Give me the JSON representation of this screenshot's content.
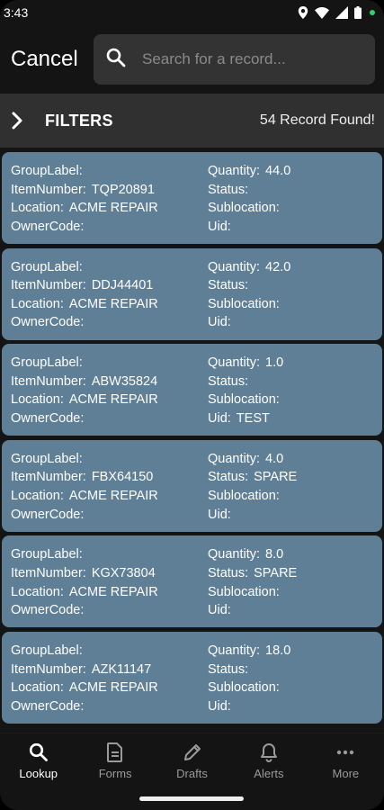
{
  "status_bar": {
    "time": "3:43"
  },
  "header": {
    "cancel_label": "Cancel",
    "search_placeholder": "Search for a record..."
  },
  "filters": {
    "label": "FILTERS",
    "record_count": "54 Record Found!"
  },
  "field_labels": {
    "group_label": "GroupLabel:",
    "item_number": "ItemNumber:",
    "location": "Location:",
    "owner_code": "OwnerCode:",
    "quantity": "Quantity:",
    "status": "Status:",
    "sublocation": "Sublocation:",
    "uid": "Uid:"
  },
  "records": [
    {
      "group_label": "",
      "item_number": "TQP20891",
      "location": "ACME REPAIR",
      "owner_code": "",
      "quantity": "44.0",
      "status": "",
      "sublocation": "",
      "uid": ""
    },
    {
      "group_label": "",
      "item_number": "DDJ44401",
      "location": "ACME REPAIR",
      "owner_code": "",
      "quantity": "42.0",
      "status": "",
      "sublocation": "",
      "uid": ""
    },
    {
      "group_label": "",
      "item_number": "ABW35824",
      "location": "ACME REPAIR",
      "owner_code": "",
      "quantity": "1.0",
      "status": "",
      "sublocation": "",
      "uid": "TEST"
    },
    {
      "group_label": "",
      "item_number": "FBX64150",
      "location": "ACME REPAIR",
      "owner_code": "",
      "quantity": "4.0",
      "status": "SPARE",
      "sublocation": "",
      "uid": ""
    },
    {
      "group_label": "",
      "item_number": "KGX73804",
      "location": "ACME REPAIR",
      "owner_code": "",
      "quantity": "8.0",
      "status": "SPARE",
      "sublocation": "",
      "uid": ""
    },
    {
      "group_label": "",
      "item_number": "AZK11147",
      "location": "ACME REPAIR",
      "owner_code": "",
      "quantity": "18.0",
      "status": "",
      "sublocation": "",
      "uid": ""
    }
  ],
  "bottom_nav": [
    {
      "label": "Lookup",
      "icon": "search-icon",
      "active": true
    },
    {
      "label": "Forms",
      "icon": "document-icon",
      "active": false
    },
    {
      "label": "Drafts",
      "icon": "pencil-icon",
      "active": false
    },
    {
      "label": "Alerts",
      "icon": "bell-icon",
      "active": false
    },
    {
      "label": "More",
      "icon": "more-icon",
      "active": false
    }
  ],
  "colors": {
    "card_background": "#5f7f96",
    "filters_bar": "#303030",
    "search_box": "#333333",
    "app_background": "#141414"
  }
}
